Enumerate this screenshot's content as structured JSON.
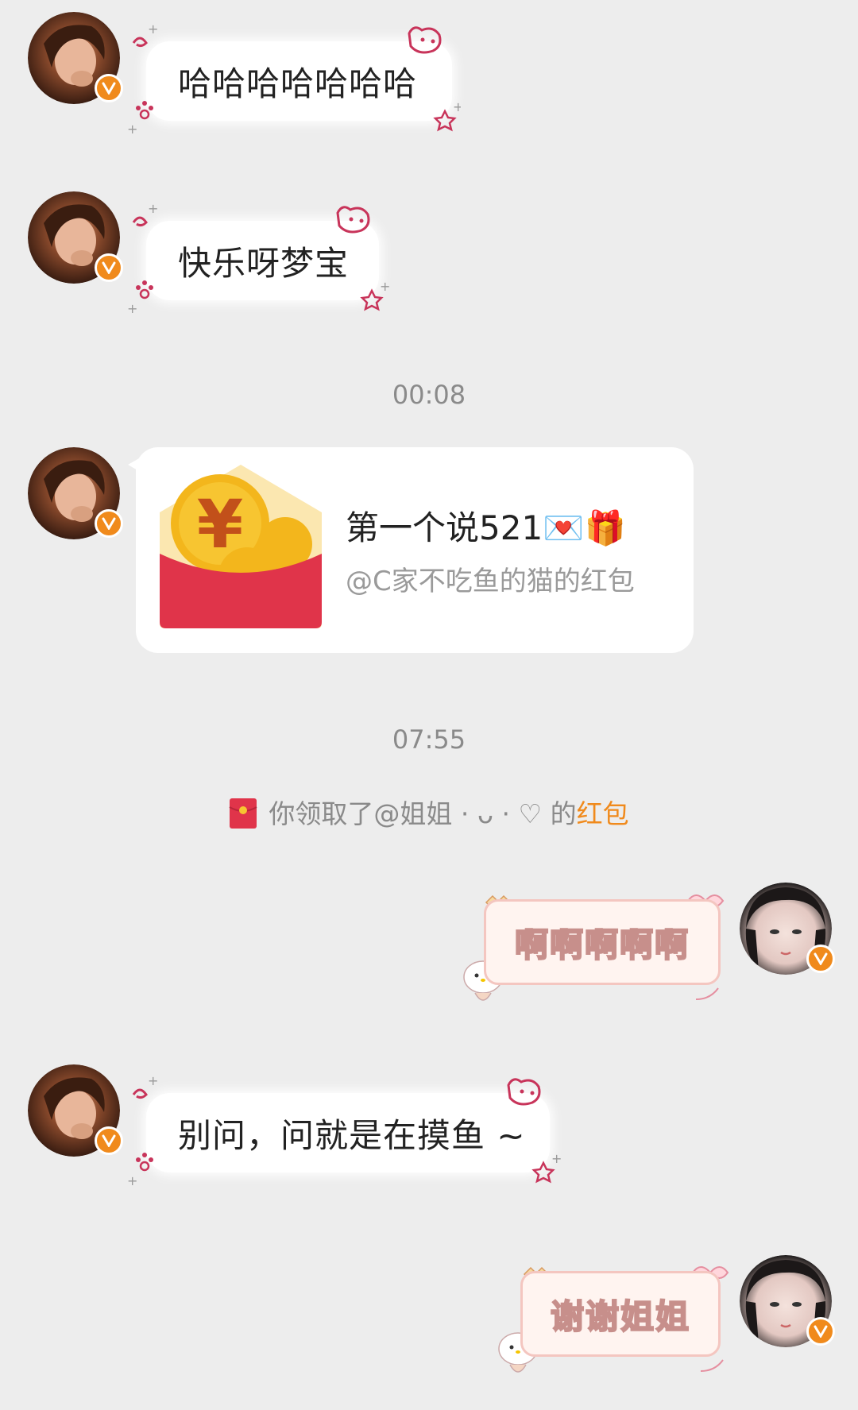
{
  "messages": {
    "m1": {
      "text": "哈哈哈哈哈哈哈"
    },
    "m2": {
      "text": "快乐呀梦宝"
    },
    "m5": {
      "text": "别问，问就是在摸鱼 ~"
    }
  },
  "times": {
    "t1": "00:08",
    "t2": "07:55"
  },
  "red_packet": {
    "title": "第一个说521💌🎁",
    "sender": "@C家不吃鱼的猫的红包"
  },
  "notice": {
    "prefix": "你领取了@姐姐 · ᴗ · ♡ 的",
    "highlight": "红包"
  },
  "my_messages": {
    "m4": {
      "text": "啊啊啊啊啊"
    },
    "m6": {
      "text": "谢谢姐姐"
    }
  },
  "icons": {
    "verified": "verified-v-badge",
    "red_packet": "red-packet-icon"
  },
  "colors": {
    "accent": "#f08a1c",
    "packet_red": "#e0344a",
    "background": "#ededed"
  }
}
